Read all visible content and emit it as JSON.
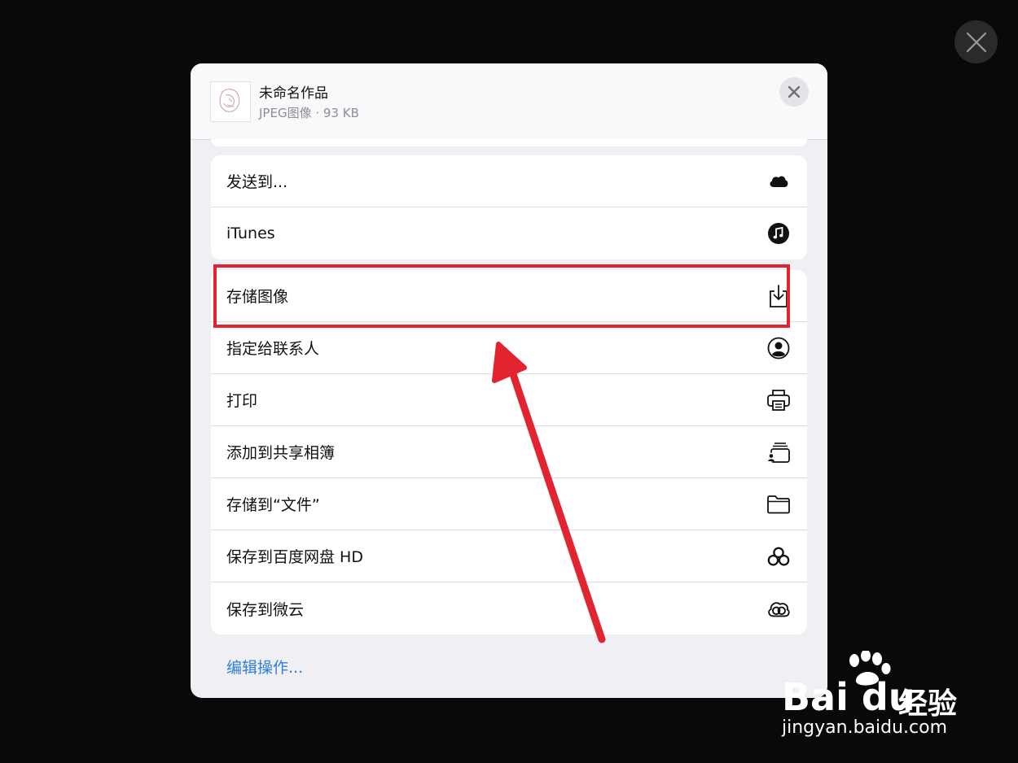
{
  "header": {
    "file_name": "未命名作品",
    "file_meta": "JPEG图像 · 93 KB"
  },
  "groups": [
    {
      "items": [
        {
          "label": "发送到...",
          "icon": "cloud-icon"
        },
        {
          "label": "iTunes",
          "icon": "music-note-icon"
        }
      ]
    },
    {
      "items": [
        {
          "label": "存储图像",
          "icon": "save-image-icon"
        },
        {
          "label": "指定给联系人",
          "icon": "contact-icon"
        },
        {
          "label": "打印",
          "icon": "printer-icon"
        },
        {
          "label": "添加到共享相簿",
          "icon": "shared-album-icon"
        },
        {
          "label": "存储到“文件”",
          "icon": "folder-icon"
        },
        {
          "label": "保存到百度网盘 HD",
          "icon": "baidu-netdisk-icon"
        },
        {
          "label": "保存到微云",
          "icon": "weiyun-icon"
        }
      ]
    }
  ],
  "footer": {
    "edit_actions": "编辑操作..."
  },
  "annotation": {
    "color": "#e1242f",
    "highlighted_item": "存储图像"
  },
  "watermark": {
    "logo": "Bai du",
    "label": "经验",
    "url": "jingyan.baidu.com"
  },
  "colors": {
    "link": "#2f80d8",
    "sheet_bg": "#efeff4",
    "backdrop": "#080908"
  }
}
